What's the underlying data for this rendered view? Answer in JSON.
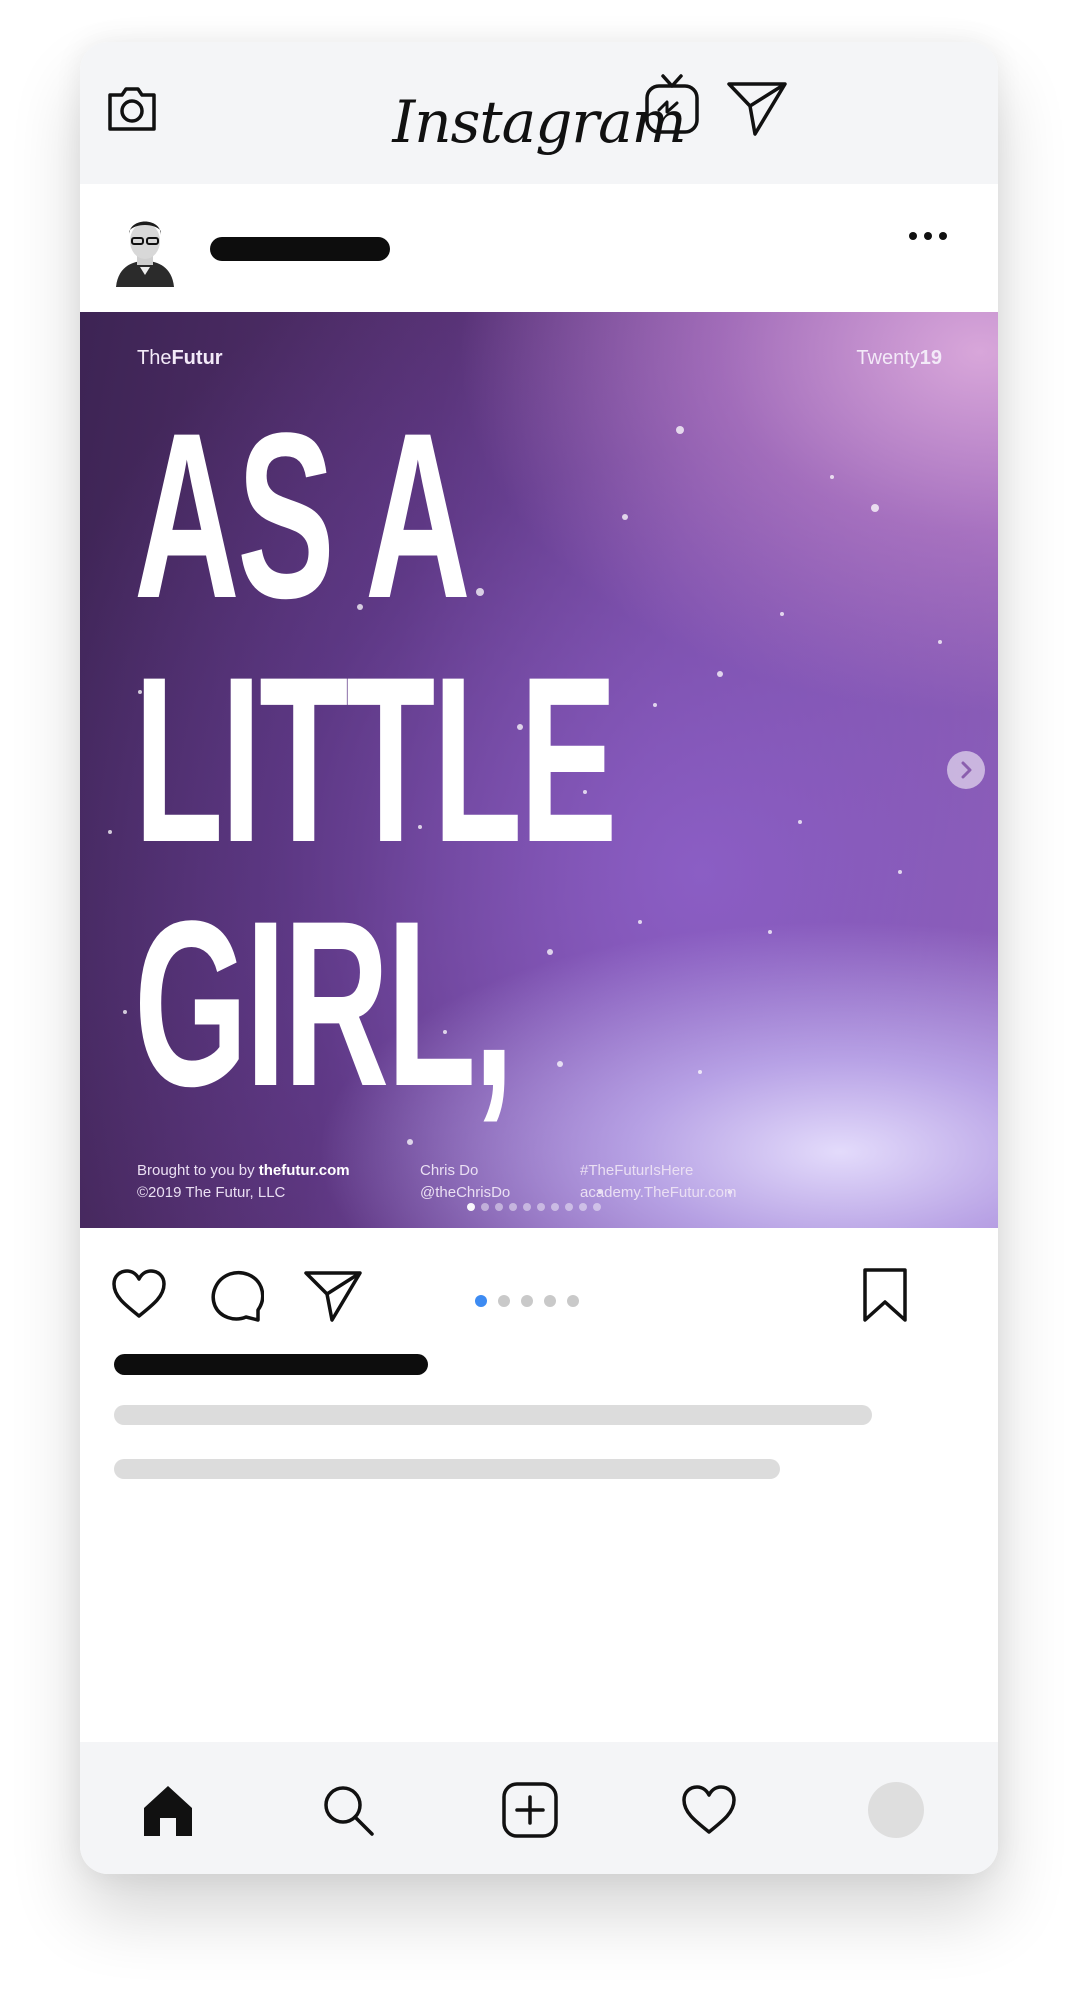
{
  "app": {
    "title": "Instagram"
  },
  "post_image": {
    "brand_prefix": "The",
    "brand_bold": "Futur",
    "year_prefix": "Twenty",
    "year_bold": "19",
    "headline_lines": [
      "AS A",
      "LITTLE",
      "GIRL,"
    ],
    "footer": {
      "col1_line1_prefix": "Brought to you by ",
      "col1_line1_bold": "thefutur.com",
      "col1_line2": "©2019 The Futur, LLC",
      "col2_line1": "Chris Do",
      "col2_line2": "@theChrisDo",
      "col3_line1": "#TheFuturIsHere",
      "col3_line2": "academy.TheFutur.com"
    },
    "inner_slides": 10,
    "inner_active": 0
  },
  "carousel": {
    "count": 5,
    "active": 0,
    "active_color": "#3d8bf2"
  },
  "icons": {
    "top": [
      "camera-icon",
      "igtv-icon",
      "direct-message-icon"
    ],
    "post": [
      "more-options-icon",
      "next-slide-icon"
    ],
    "actions": [
      "like-heart-icon",
      "comment-icon",
      "share-icon",
      "bookmark-icon"
    ],
    "nav": [
      "home-icon",
      "search-icon",
      "new-post-icon",
      "activity-heart-icon",
      "profile-avatar"
    ]
  }
}
